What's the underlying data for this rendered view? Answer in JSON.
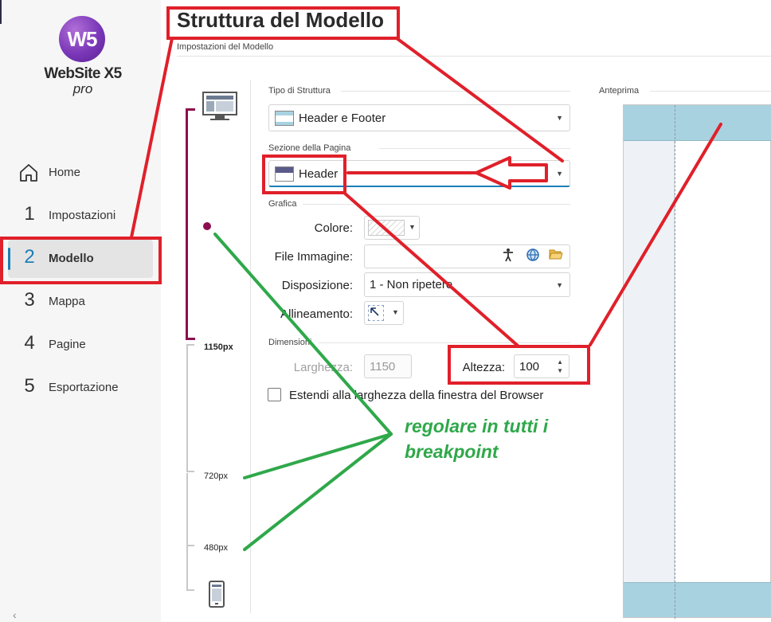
{
  "app": {
    "logo_text": "W5",
    "logo_name": "WebSite X5",
    "logo_sub": "pro"
  },
  "sidebar": {
    "items": [
      {
        "num": "",
        "label": "Home",
        "icon": "home-icon"
      },
      {
        "num": "1",
        "label": "Impostazioni"
      },
      {
        "num": "2",
        "label": "Modello",
        "active": true
      },
      {
        "num": "3",
        "label": "Mappa"
      },
      {
        "num": "4",
        "label": "Pagine"
      },
      {
        "num": "5",
        "label": "Esportazione"
      }
    ],
    "collapse_glyph": "‹"
  },
  "header": {
    "title": "Struttura del Modello",
    "subtitle": "Impostazioni del Modello"
  },
  "breakpoints": {
    "labels": [
      "1150px",
      "720px",
      "480px"
    ],
    "icons": [
      "monitor-icon",
      "phone-icon"
    ]
  },
  "form": {
    "structure_type": {
      "section": "Tipo di Struttura",
      "value": "Header e Footer"
    },
    "page_section": {
      "section": "Sezione della Pagina",
      "value": "Header"
    },
    "graphics": {
      "section": "Grafica",
      "color_label": "Colore:",
      "image_label": "File Immagine:",
      "image_value": "",
      "layout_label": "Disposizione:",
      "layout_value": "1 - Non ripetere",
      "align_label": "Allineamento:",
      "file_icons": [
        "accessibility-icon",
        "web-globe-icon",
        "folder-open-icon"
      ]
    },
    "dimensions": {
      "section": "Dimensioni",
      "width_label": "Larghezza:",
      "width_value": "1150",
      "height_label": "Altezza:",
      "height_value": "100"
    },
    "stretch_checkbox": {
      "label": "Estendi alla larghezza della finestra del Browser",
      "checked": false
    }
  },
  "preview": {
    "label": "Anteprima"
  },
  "annotation": {
    "line1": "regolare in tutti i",
    "line2": "breakpoint"
  },
  "colors": {
    "annotation_red": "#e0202a",
    "annotation_green": "#2fa84a",
    "breakpoint_accent": "#8b0f4e",
    "active_accent": "#1a7fb6",
    "preview_header": "#a9d2e0"
  }
}
